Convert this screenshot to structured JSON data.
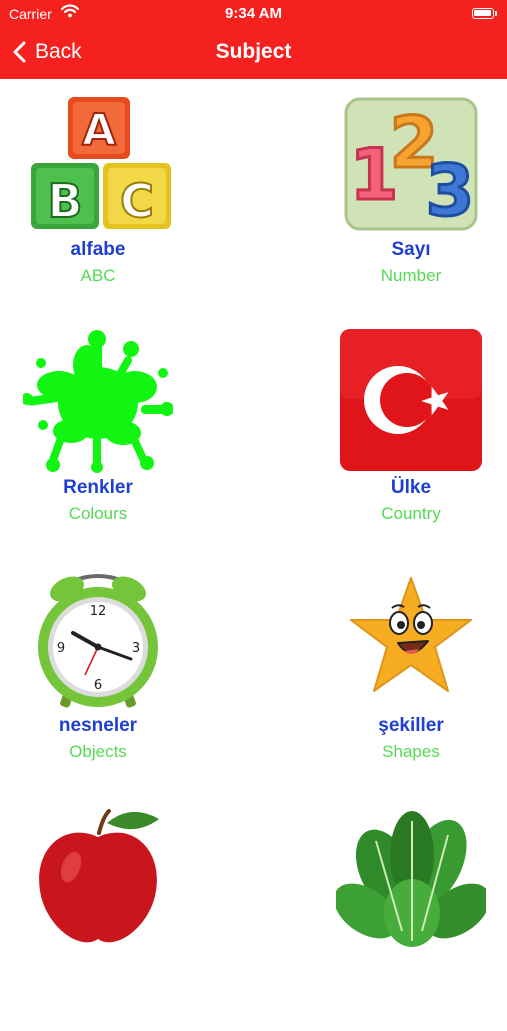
{
  "status_bar": {
    "carrier": "Carrier",
    "time": "9:34 AM"
  },
  "nav": {
    "back_label": "Back",
    "title": "Subject"
  },
  "colors": {
    "bar": "#f5211f",
    "turkish_label": "#1f3fd0",
    "english_label": "#55d955"
  },
  "subjects": [
    {
      "turkish": "alfabe",
      "english": "ABC",
      "icon": "abc-blocks-icon"
    },
    {
      "turkish": "Sayı",
      "english": "Number",
      "icon": "numbers-123-icon"
    },
    {
      "turkish": "Renkler",
      "english": "Colours",
      "icon": "paint-splash-icon"
    },
    {
      "turkish": "Ülke",
      "english": "Country",
      "icon": "turkish-flag-icon"
    },
    {
      "turkish": "nesneler",
      "english": "Objects",
      "icon": "alarm-clock-icon"
    },
    {
      "turkish": "şekiller",
      "english": "Shapes",
      "icon": "smiling-star-icon"
    },
    {
      "turkish": "",
      "english": "",
      "icon": "red-apple-icon"
    },
    {
      "turkish": "",
      "english": "",
      "icon": "spinach-icon"
    }
  ]
}
